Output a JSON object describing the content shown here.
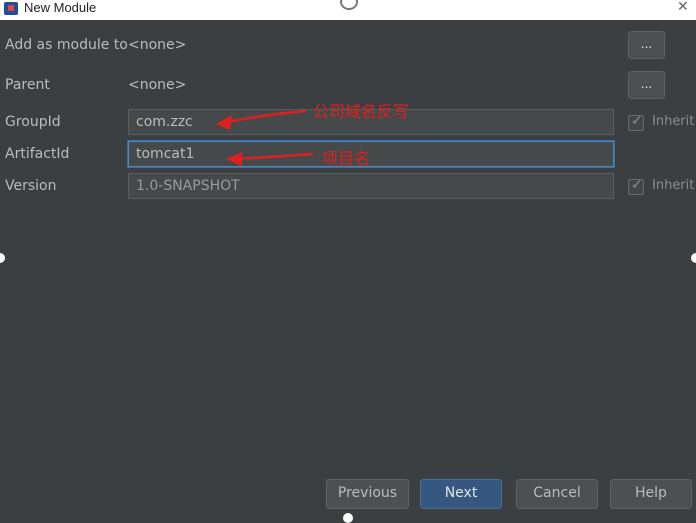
{
  "window": {
    "title": "New Module"
  },
  "form": {
    "add_as_module": {
      "label": "Add as module to",
      "value": "<none>",
      "button": "..."
    },
    "parent": {
      "label": "Parent",
      "value": "<none>",
      "button": "..."
    },
    "group_id": {
      "label": "GroupId",
      "value": "com.zzc",
      "inherit": "Inherit"
    },
    "artifact_id": {
      "label": "ArtifactId",
      "value": "tomcat1"
    },
    "version": {
      "label": "Version",
      "value": "1.0-SNAPSHOT",
      "inherit": "Inherit"
    }
  },
  "annotations": {
    "group_note": "公司域名反写",
    "artifact_note": "项目名",
    "color": "#e0201f"
  },
  "buttons": {
    "previous": "Previous",
    "next": "Next",
    "cancel": "Cancel",
    "help": "Help"
  },
  "colors": {
    "background": "#3c3f41",
    "primary_button": "#365880",
    "focus_border": "#4a88c7"
  }
}
